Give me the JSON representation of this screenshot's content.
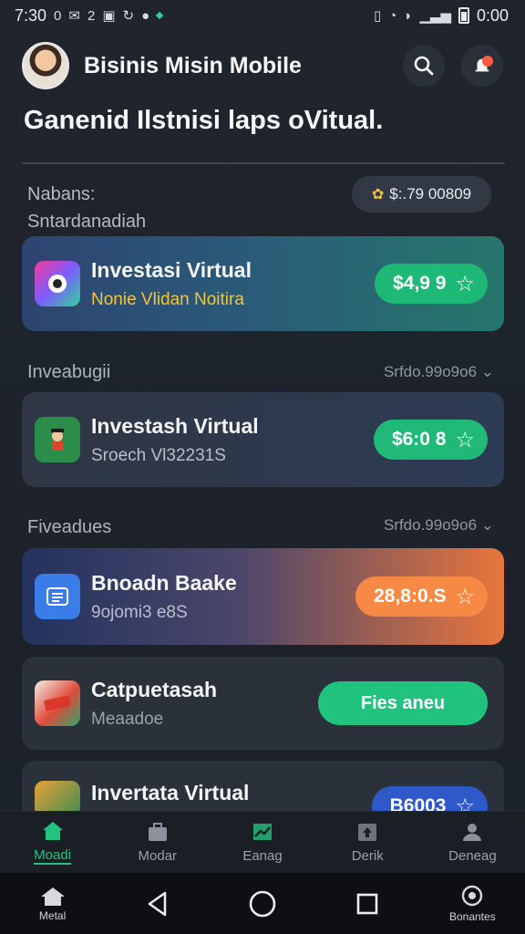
{
  "status_bar": {
    "time": "7:30",
    "left_icons": [
      "0",
      "2"
    ],
    "right_time": "0:00"
  },
  "header": {
    "title": "Bisinis Misin Mobile"
  },
  "headline": "Ganenid Ilstnisi laps oVitual.",
  "balance": {
    "label_line1": "Nabans:",
    "label_line2": "Sntardanadiah",
    "amount": "$:.79 00809"
  },
  "sections": [
    {
      "label": "Inveabugii",
      "meta": "Srfdo.99o9o6 ⌄"
    },
    {
      "label": "Fiveadues",
      "meta": "Srfdo.99o9o6 ⌄"
    }
  ],
  "cards": [
    {
      "title": "Investasi Virtual",
      "subtitle": "Nonie Vlidan Noitira",
      "price": "$4,9 9"
    },
    {
      "title": "Investash Virtual",
      "subtitle": "Sroech Vl32231S",
      "price": "$6:0 8"
    },
    {
      "title": "Bnoadn Baake",
      "subtitle": "9ojomi3 e8S",
      "price": "28,8:0.S"
    },
    {
      "title": "Catpuetasah",
      "subtitle": "Meaadoe",
      "action": "Fies aneu"
    },
    {
      "title": "Invertata Virtual",
      "price": "B6003"
    }
  ],
  "bottom_nav": [
    {
      "label": "Moadi",
      "icon": "home-icon",
      "active": true
    },
    {
      "label": "Modar",
      "icon": "briefcase-icon",
      "active": false
    },
    {
      "label": "Eanag",
      "icon": "chart-icon",
      "active": false
    },
    {
      "label": "Derik",
      "icon": "upload-icon",
      "active": false
    },
    {
      "label": "Deneag",
      "icon": "user-icon",
      "active": false
    }
  ],
  "system_nav": {
    "home_label": "Metal",
    "right_label": "Bonantes"
  },
  "colors": {
    "accent_green": "#22c37e",
    "accent_orange": "#f68a45",
    "accent_blue": "#2f58c8",
    "background": "#1b1f26"
  }
}
